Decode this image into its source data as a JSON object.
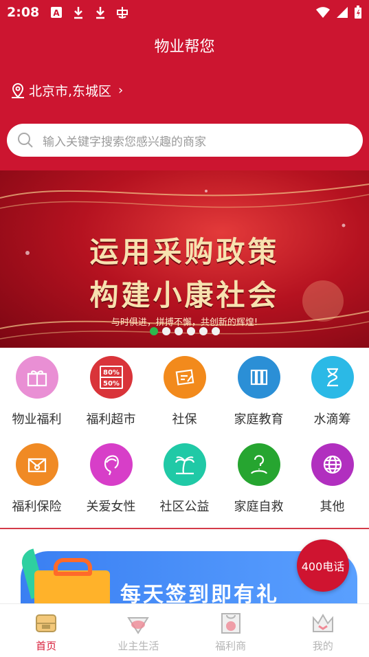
{
  "status_bar": {
    "time": "2:08"
  },
  "header": {
    "title": "物业帮您",
    "location": "北京市,东城区",
    "search_placeholder": "输入关键字搜索您感兴趣的商家"
  },
  "banner": {
    "line1": "运用采购政策",
    "line2": "构建小康社会",
    "subtitle": "与时俱进，拼搏不懈，共创新的辉煌!",
    "dot_count": 6,
    "active_dot": 0
  },
  "categories": [
    {
      "label": "物业福利",
      "icon": "gift-box-icon",
      "color": "#e98fd4"
    },
    {
      "label": "福利超市",
      "icon": "discount-tag-icon",
      "color": "#d9343a",
      "badge_top": "80%",
      "badge_bottom": "50%"
    },
    {
      "label": "社保",
      "icon": "document-pen-icon",
      "color": "#f28a1c"
    },
    {
      "label": "家庭教育",
      "icon": "books-icon",
      "color": "#2b8fd6"
    },
    {
      "label": "水滴筹",
      "icon": "hourglass-icon",
      "color": "#2bb9e6"
    },
    {
      "label": "福利保险",
      "icon": "email-icon",
      "color": "#f08a24"
    },
    {
      "label": "关爱女性",
      "icon": "woman-profile-icon",
      "color": "#d73ec8"
    },
    {
      "label": "社区公益",
      "icon": "palm-tree-icon",
      "color": "#20c9a6"
    },
    {
      "label": "家庭自救",
      "icon": "help-person-icon",
      "color": "#26a530"
    },
    {
      "label": "其他",
      "icon": "globe-icon",
      "color": "#b12fbf"
    }
  ],
  "promo": {
    "text": "每天签到即有礼"
  },
  "call_badge": "400电话",
  "tabs": [
    {
      "label": "首页",
      "icon": "home-icon",
      "active": true
    },
    {
      "label": "业主生活",
      "icon": "diamond-icon",
      "active": false
    },
    {
      "label": "福利商",
      "icon": "shopping-bag-icon",
      "active": false
    },
    {
      "label": "我的",
      "icon": "crown-icon",
      "active": false
    }
  ]
}
